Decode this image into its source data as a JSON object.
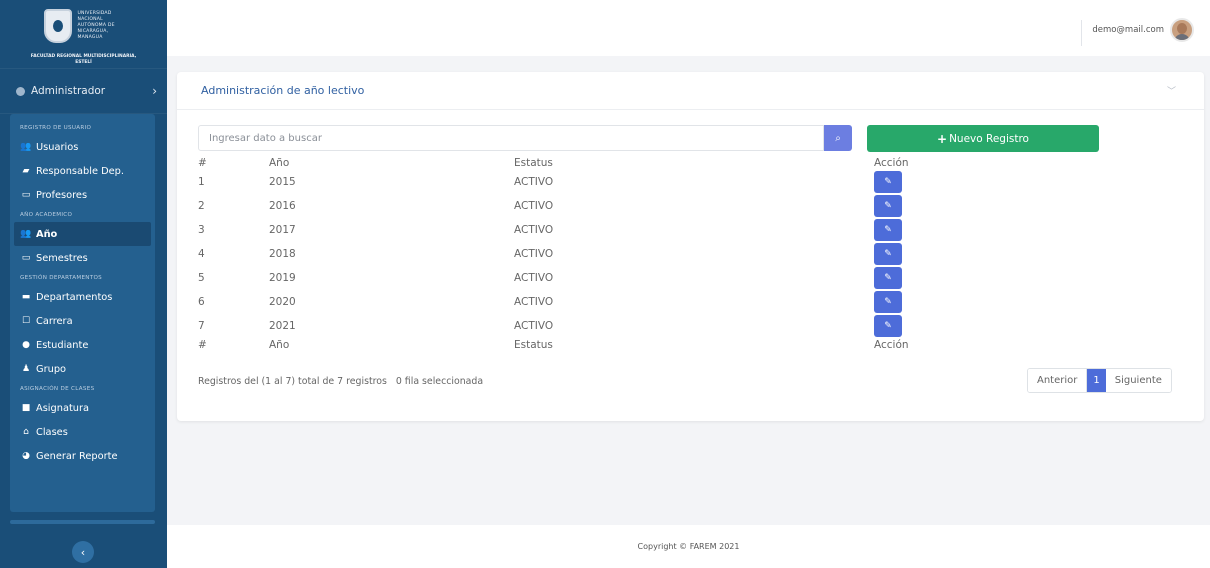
{
  "brand": {
    "university_lines": [
      "UNIVERSIDAD",
      "NACIONAL",
      "AUTÓNOMA DE",
      "NICARAGUA,",
      "MANAGUA"
    ],
    "faculty_line1": "FACULTAD REGIONAL MULTIDISCIPLINARIA,",
    "faculty_line2": "ESTELÍ"
  },
  "user_menu": {
    "label": "Administrador"
  },
  "sidebar": {
    "sections": [
      {
        "title": "REGISTRO DE USUARIO",
        "items": [
          {
            "label": "Usuarios",
            "icon": "users-icon"
          },
          {
            "label": "Responsable Dep.",
            "icon": "building-icon"
          },
          {
            "label": "Profesores",
            "icon": "chalkboard-icon"
          }
        ]
      },
      {
        "title": "AÑO ACADEMICO",
        "items": [
          {
            "label": "Año",
            "icon": "users-icon",
            "active": true
          },
          {
            "label": "Semestres",
            "icon": "chalkboard-icon"
          }
        ]
      },
      {
        "title": "GESTIÓN DEPARTAMENTOS",
        "items": [
          {
            "label": "Departamentos",
            "icon": "folder-icon"
          },
          {
            "label": "Carrera",
            "icon": "bookmark-icon"
          },
          {
            "label": "Estudiante",
            "icon": "user-icon"
          },
          {
            "label": "Grupo",
            "icon": "group-icon"
          }
        ]
      },
      {
        "title": "ASIGNACIÓN DE CLASES",
        "items": [
          {
            "label": "Asignatura",
            "icon": "book-icon"
          },
          {
            "label": "Clases",
            "icon": "institution-icon"
          },
          {
            "label": "Generar Reporte",
            "icon": "pie-chart-icon"
          }
        ]
      }
    ]
  },
  "topbar": {
    "email": "demo@mail.com"
  },
  "card": {
    "title": "Administración de año lectivo",
    "search_placeholder": "Ingresar dato a buscar",
    "new_button": "Nuevo Registro",
    "columns": [
      "#",
      "Año",
      "Estatus",
      "Acción"
    ],
    "rows": [
      {
        "num": "1",
        "year": "2015",
        "status": "ACTIVO"
      },
      {
        "num": "2",
        "year": "2016",
        "status": "ACTIVO"
      },
      {
        "num": "3",
        "year": "2017",
        "status": "ACTIVO"
      },
      {
        "num": "4",
        "year": "2018",
        "status": "ACTIVO"
      },
      {
        "num": "5",
        "year": "2019",
        "status": "ACTIVO"
      },
      {
        "num": "6",
        "year": "2020",
        "status": "ACTIVO"
      },
      {
        "num": "7",
        "year": "2021",
        "status": "ACTIVO"
      }
    ],
    "info": "Registros del (1 al 7) total de 7 registros   0 fila seleccionada",
    "pager": {
      "prev": "Anterior",
      "current": "1",
      "next": "Siguiente"
    }
  },
  "footer": {
    "text": "Copyright © FAREM 2021"
  },
  "colors": {
    "sidebar": "#1a4e78",
    "accent": "#4d6cd9",
    "success": "#28a86a"
  }
}
